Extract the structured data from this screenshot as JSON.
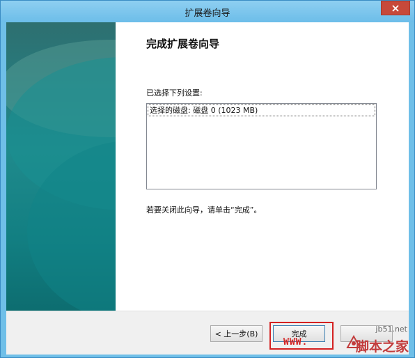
{
  "window": {
    "title": "扩展卷向导"
  },
  "main": {
    "heading": "完成扩展卷向导",
    "settings_label": "已选择下列设置:",
    "settings_list": [
      "选择的磁盘: 磁盘 0 (1023 MB)"
    ],
    "close_hint": "若要关闭此向导，请单击“完成”。"
  },
  "footer": {
    "back_label": "< 上一步(B)",
    "finish_label": "完成",
    "cancel_label": ""
  },
  "watermark": {
    "www": "WWW.",
    "site": "jb51.net",
    "cn": "脚本之家"
  },
  "colors": {
    "titlebar": "#6cbde9",
    "close_button": "#c7493a",
    "side_panel": "#1f8a8c",
    "highlight": "#d42121"
  },
  "icons": [
    "close-icon",
    "jb51-logo-icon"
  ]
}
